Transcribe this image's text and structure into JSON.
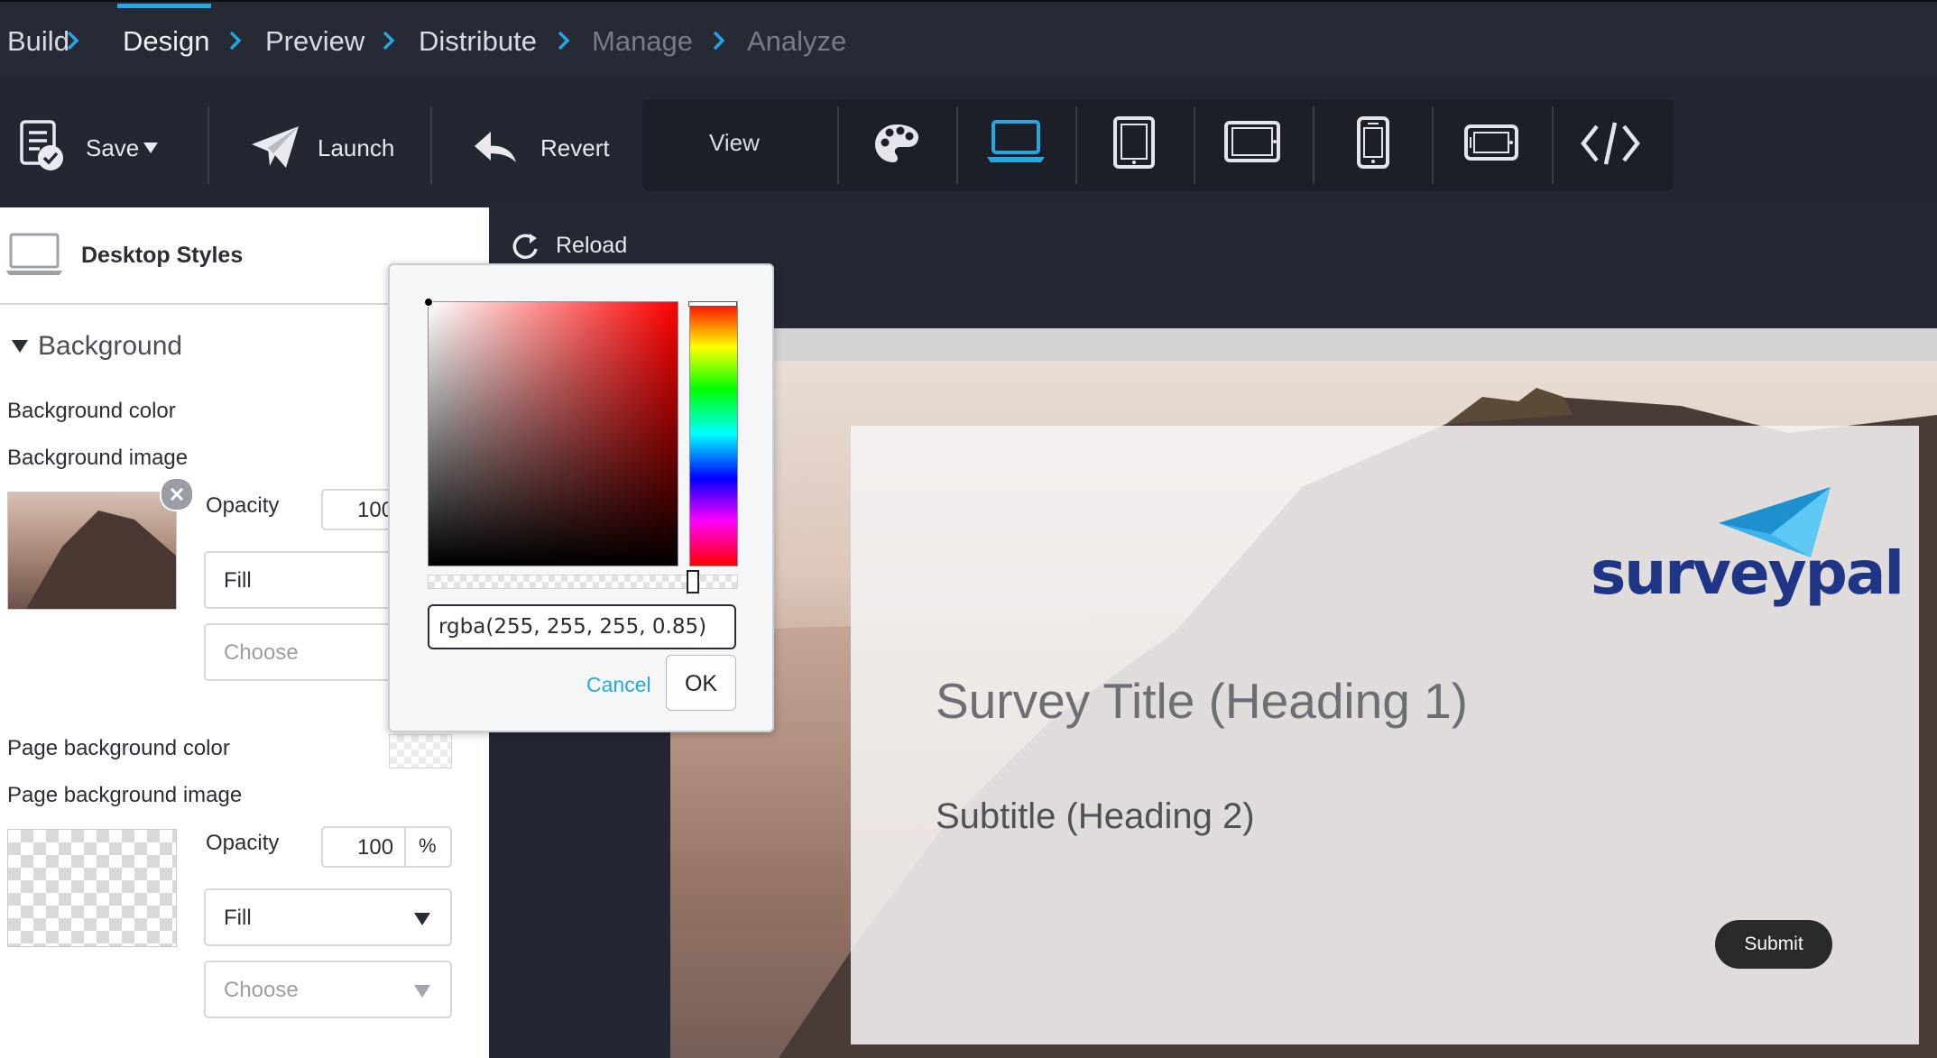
{
  "nav": {
    "steps": [
      {
        "label": "Build"
      },
      {
        "label": "Design"
      },
      {
        "label": "Preview"
      },
      {
        "label": "Distribute"
      },
      {
        "label": "Manage"
      },
      {
        "label": "Analyze"
      }
    ],
    "active_step": "Design"
  },
  "toolbar": {
    "save_label": "Save",
    "launch_label": "Launch",
    "revert_label": "Revert",
    "view_label": "View",
    "view_icons": [
      "palette-icon",
      "laptop-icon",
      "tablet-portrait-icon",
      "tablet-landscape-icon",
      "phone-portrait-icon",
      "phone-landscape-icon",
      "code-icon"
    ],
    "selected_view": "laptop-icon"
  },
  "panel": {
    "title": "Desktop Styles",
    "section_title": "Background",
    "background_color_label": "Background color",
    "background_image_label": "Background image",
    "opacity_label": "Opacity",
    "bg_opacity_value": "100",
    "bg_fill_value": "Fill",
    "bg_choose_placeholder": "Choose",
    "page_bg_color_label": "Page background color",
    "page_bg_image_label": "Page background image",
    "page_opacity_value": "100",
    "percent_unit": "%",
    "page_fill_value": "Fill",
    "page_choose_placeholder": "Choose"
  },
  "preview": {
    "reload_label": "Reload",
    "logo_text": "surveypal",
    "survey_title": "Survey Title (Heading 1)",
    "subtitle": "Subtitle (Heading 2)",
    "submit_label": "Submit"
  },
  "color_picker": {
    "value": "rgba(255, 255, 255, 0.85)",
    "cancel_label": "Cancel",
    "ok_label": "OK",
    "hue_color": "#ff0000",
    "alpha": 0.85
  },
  "colors": {
    "accent": "#27a6e0",
    "nav_bg": "#252a35",
    "logo_blue": "#1e3685",
    "logo_plane": "#3bb3ea"
  }
}
